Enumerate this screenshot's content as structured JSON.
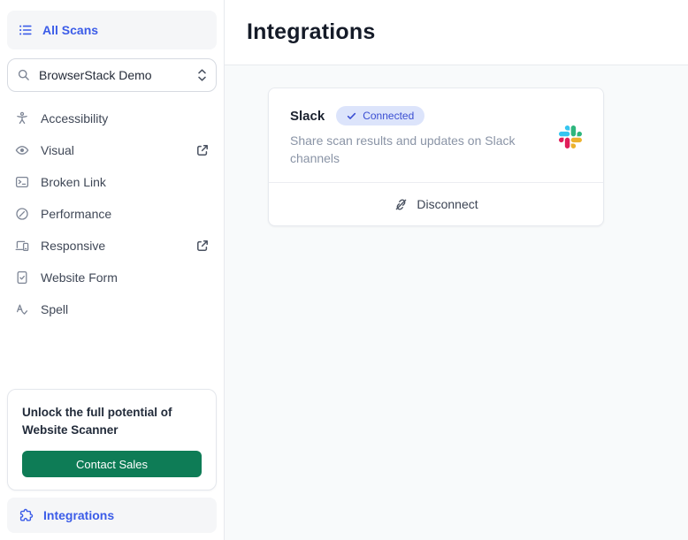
{
  "sidebar": {
    "all_scans_label": "All Scans",
    "project_selector": {
      "value": "BrowserStack Demo"
    },
    "menu": [
      {
        "label": "Accessibility",
        "icon": "accessibility-icon",
        "external_link": false
      },
      {
        "label": "Visual",
        "icon": "eye-icon",
        "external_link": true
      },
      {
        "label": "Broken Link",
        "icon": "terminal-window-icon",
        "external_link": false
      },
      {
        "label": "Performance",
        "icon": "gauge-icon",
        "external_link": false
      },
      {
        "label": "Responsive",
        "icon": "devices-icon",
        "external_link": true
      },
      {
        "label": "Website Form",
        "icon": "document-check-icon",
        "external_link": false
      },
      {
        "label": "Spell",
        "icon": "spellcheck-icon",
        "external_link": false
      }
    ],
    "upsell": {
      "message": "Unlock the full potential of Website Scanner",
      "cta_label": "Contact Sales"
    },
    "integrations_label": "Integrations"
  },
  "main": {
    "title": "Integrations",
    "integration_card": {
      "name": "Slack",
      "status_badge": "Connected",
      "description": "Share scan results and updates on Slack channels",
      "action_label": "Disconnect"
    }
  },
  "icons": {
    "all_scans": "list-icon",
    "selector_left": "search-icon",
    "selector_right": "up-down-chevrons-icon",
    "integrations": "puzzle-icon",
    "badge": "check-icon",
    "card_logo": "slack-logo-icon",
    "footer_action": "unlink-icon",
    "external": "external-link-icon"
  },
  "colors": {
    "accent_blue": "#3b5ce8",
    "cta_green": "#0e7c56",
    "badge_bg": "#dce4fb",
    "badge_text": "#3a4ed2",
    "content_bg": "#f8fafb",
    "slack_blue": "#36C5F0",
    "slack_green": "#2EB67D",
    "slack_red": "#E01E5A",
    "slack_yellow": "#ECB22E"
  }
}
